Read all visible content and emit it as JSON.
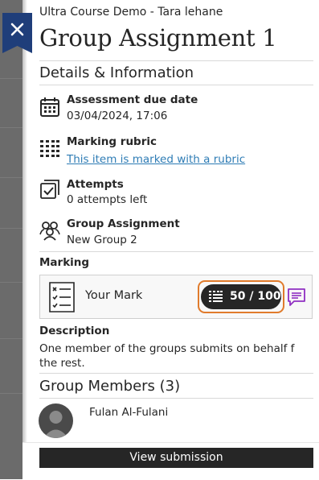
{
  "course_name": "Ultra Course Demo - Tara lehane",
  "page_title": "Group Assignment 1",
  "details_heading": "Details & Information",
  "details": {
    "due_date": {
      "label": "Assessment due date",
      "value": "03/04/2024, 17:06",
      "icon": "calendar-icon"
    },
    "rubric": {
      "label": "Marking rubric",
      "link": "This item is marked with a rubric",
      "icon": "rubric-icon"
    },
    "attempts": {
      "label": "Attempts",
      "value": "0 attempts left",
      "icon": "attempts-icon"
    },
    "group": {
      "label": "Group Assignment",
      "value": "New Group 2",
      "icon": "group-icon"
    }
  },
  "marking": {
    "label": "Marking",
    "your_mark": "Your Mark",
    "grade": "50 / 100",
    "highlight_color": "#e07b2c",
    "feedback_color": "#8f2fc2"
  },
  "description": {
    "label": "Description",
    "text": "One member of the groups submits on behalf f the rest."
  },
  "members": {
    "heading": "Group Members (3)",
    "list": [
      {
        "name": "Fulan Al-Fulani"
      }
    ]
  },
  "footer": {
    "view_submission": "View submission"
  },
  "colors": {
    "close_button": "#1f3e7a",
    "link": "#2e7cb5"
  }
}
